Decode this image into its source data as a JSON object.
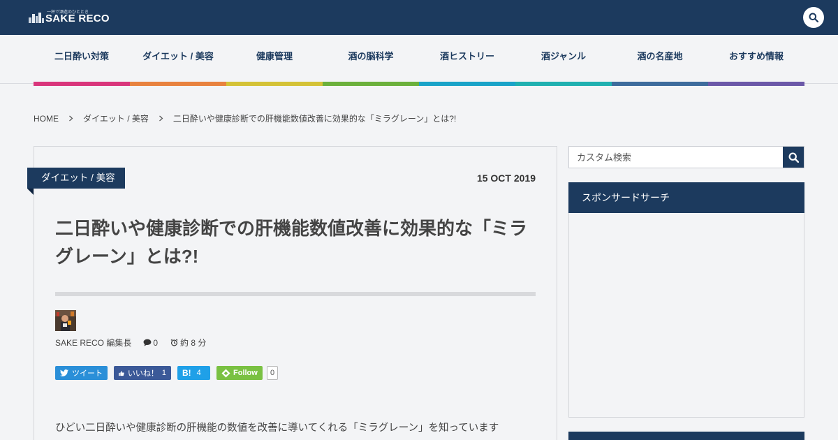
{
  "header": {
    "logo_tagline": "一杯で酒造のひととき",
    "logo_text": "SAKE RECO",
    "colors": {
      "bar": "#1c3a5e"
    },
    "search_icon": "search-icon"
  },
  "nav": {
    "items": [
      {
        "label": "二日酔い対策",
        "color": "#d9357b"
      },
      {
        "label": "ダイエット / 美容",
        "color": "#e8823e"
      },
      {
        "label": "健康管理",
        "color": "#d4c236"
      },
      {
        "label": "酒の脳科学",
        "color": "#6bb03b"
      },
      {
        "label": "酒ヒストリー",
        "color": "#19a3c8"
      },
      {
        "label": "酒ジャンル",
        "color": "#1fb0b0"
      },
      {
        "label": "酒の名産地",
        "color": "#3d6b9c"
      },
      {
        "label": "おすすめ情報",
        "color": "#6b58a8"
      }
    ]
  },
  "breadcrumb": {
    "items": [
      "HOME",
      "ダイエット / 美容",
      "二日酔いや健康診断での肝機能数値改善に効果的な「ミラグレーン」とは?!"
    ]
  },
  "article": {
    "category": "ダイエット / 美容",
    "date": "15 OCT 2019",
    "title": "二日酔いや健康診断での肝機能数値改善に効果的な「ミラグレーン」とは?!",
    "author": "SAKE RECO 編集長",
    "comments": "0",
    "read_time": "約 8 分",
    "share": {
      "tweet_label": "ツイート",
      "like_label": "いいね！",
      "like_count": "1",
      "hatena_label": "B!",
      "hatena_count": "4",
      "follow_label": "Follow",
      "follow_count": "0"
    },
    "excerpt": "ひどい二日酔いや健康診断の肝機能の数値を改善に導いてくれる「ミラグレーン」を知っています"
  },
  "sidebar": {
    "search_placeholder": "カスタム検索",
    "widget_title": "スポンサードサーチ"
  }
}
